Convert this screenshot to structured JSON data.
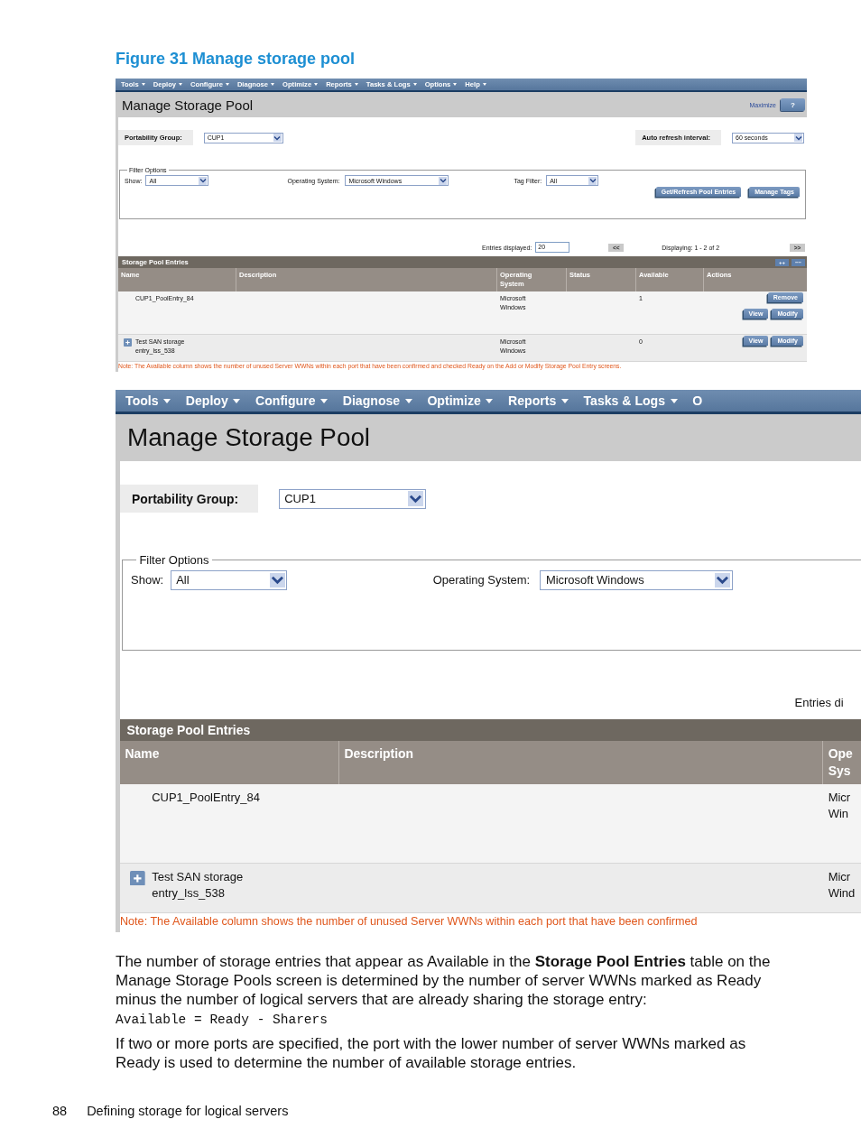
{
  "figure_caption": "Figure 31 Manage storage pool",
  "panels": [
    {
      "kind": "full",
      "menu": [
        {
          "label": "Tools",
          "caret": true
        },
        {
          "label": "Deploy",
          "caret": true
        },
        {
          "label": "Configure",
          "caret": true
        },
        {
          "label": "Diagnose",
          "caret": true
        },
        {
          "label": "Optimize",
          "caret": true
        },
        {
          "label": "Reports",
          "caret": true
        },
        {
          "label": "Tasks & Logs",
          "caret": true
        },
        {
          "label": "Options",
          "caret": true
        },
        {
          "label": "Help",
          "caret": true
        }
      ],
      "title": "Manage Storage Pool",
      "maximize": "Maximize",
      "help": "?",
      "portability": {
        "label": "Portability Group:",
        "value": "CUP1"
      },
      "refresh": {
        "label": "Auto refresh interval:",
        "value": "60 seconds"
      },
      "filter": {
        "legend": "Filter Options",
        "show_label": "Show:",
        "show_value": "All",
        "os_label": "Operating System:",
        "os_value": "Microsoft Windows",
        "tag_label": "Tag Filter:",
        "tag_value": "All",
        "buttons": [
          "Get/Refresh Pool Entries",
          "Manage Tags"
        ]
      },
      "entries": {
        "label": "Entries displayed:",
        "value": "20",
        "prev": "<<",
        "displaying": "Displaying: 1 - 2 of 2",
        "next": ">>"
      },
      "table_title": "Storage Pool Entries",
      "expand_all": "++",
      "collapse_all": "−−",
      "columns": [
        {
          "lines": [
            "Name"
          ]
        },
        {
          "lines": [
            "Description"
          ]
        },
        {
          "lines": [
            "Operating",
            "System"
          ]
        },
        {
          "lines": [
            "Status"
          ]
        },
        {
          "lines": [
            "Available"
          ]
        },
        {
          "lines": [
            "Actions"
          ]
        }
      ],
      "rows": [
        {
          "expander": false,
          "name": [
            "CUP1_PoolEntry_84"
          ],
          "os": [
            "Microsoft",
            "Windows"
          ],
          "available": "1",
          "actions": [
            [
              "Remove"
            ],
            [
              "View",
              "Modify"
            ]
          ]
        },
        {
          "expander": true,
          "name": [
            "Test SAN storage",
            "entry_lss_538"
          ],
          "os": [
            "Microsoft",
            "Windows"
          ],
          "available": "0",
          "actions": [
            [
              "View",
              "Modify"
            ]
          ]
        }
      ],
      "note": "Note: The Available column shows the number of unused Server WWNs within each port that have been confirmed and checked Ready on the Add or Modify Storage Pool Entry screens."
    },
    {
      "kind": "magnified",
      "menu": [
        {
          "label": "Tools",
          "caret": true
        },
        {
          "label": "Deploy",
          "caret": true
        },
        {
          "label": "Configure",
          "caret": true
        },
        {
          "label": "Diagnose",
          "caret": true
        },
        {
          "label": "Optimize",
          "caret": true
        },
        {
          "label": "Reports",
          "caret": true
        },
        {
          "label": "Tasks & Logs",
          "caret": true
        },
        {
          "label": "O",
          "caret": false
        }
      ],
      "title": "Manage Storage Pool",
      "portability": {
        "label": "Portability Group:",
        "value": "CUP1"
      },
      "filter": {
        "legend": "Filter Options",
        "show_label": "Show:",
        "show_value": "All",
        "os_label": "Operating System:",
        "os_value": "Microsoft Windows"
      },
      "entries": {
        "label": "Entries di"
      },
      "table_title": "Storage Pool Entries",
      "columns": [
        {
          "lines": [
            "Name"
          ]
        },
        {
          "lines": [
            "Description"
          ]
        },
        {
          "lines": [
            "Ope",
            "Sys"
          ]
        }
      ],
      "rows": [
        {
          "expander": false,
          "name": [
            "CUP1_PoolEntry_84"
          ],
          "os": [
            "Micr",
            "Win"
          ]
        },
        {
          "expander": true,
          "name": [
            "Test SAN storage",
            "entry_lss_538"
          ],
          "os": [
            "Micr",
            "Wind"
          ]
        }
      ],
      "note": "Note: The Available column shows the number of unused Server WWNs within each port that have been confirmed"
    }
  ],
  "body": [
    {
      "kind": "text",
      "text": "The number of storage entries that appear as Available in the **Storage Pool Entries** table on the Manage Storage Pools screen is determined by the number of server WWNs marked as Ready minus the number of logical servers that are already sharing the storage entry:"
    },
    {
      "kind": "code",
      "text": "Available = Ready - Sharers"
    },
    {
      "kind": "text",
      "text": "If two or more ports are specified, the port with the lower number of server WWNs marked as Ready is used to determine the number of available storage entries."
    }
  ],
  "footer": {
    "page_number": "88",
    "section": "Defining storage for logical servers"
  }
}
